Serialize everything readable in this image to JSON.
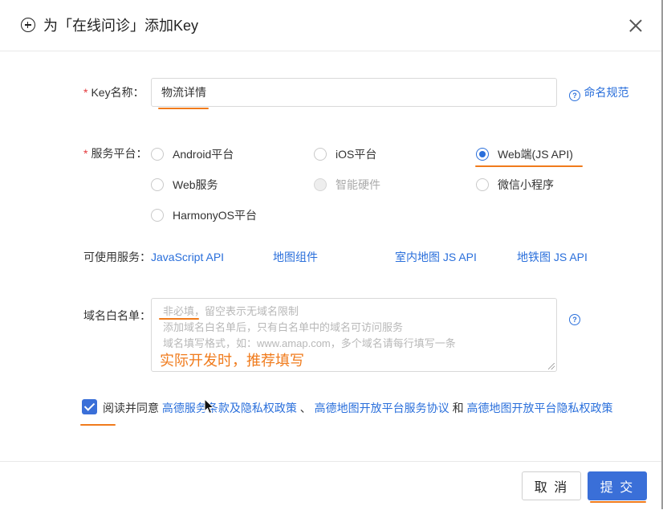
{
  "dialog": {
    "title": "为「在线问诊」添加Key",
    "icons": {
      "add": "plus-circle-icon",
      "close": "close-icon"
    }
  },
  "key_name": {
    "label": "Key名称：",
    "value": "物流详情",
    "help_link": "命名规范"
  },
  "platform": {
    "label": "服务平台：",
    "options": [
      {
        "label": "Android平台",
        "checked": false,
        "disabled": false
      },
      {
        "label": "iOS平台",
        "checked": false,
        "disabled": false
      },
      {
        "label": "Web端(JS API)",
        "checked": true,
        "disabled": false
      },
      {
        "label": "Web服务",
        "checked": false,
        "disabled": false
      },
      {
        "label": "智能硬件",
        "checked": false,
        "disabled": true
      },
      {
        "label": "微信小程序",
        "checked": false,
        "disabled": false
      },
      {
        "label": "HarmonyOS平台",
        "checked": false,
        "disabled": false
      }
    ]
  },
  "available_services": {
    "label": "可使用服务：",
    "items": [
      "JavaScript API",
      "地图组件",
      "室内地图 JS API",
      "地铁图 JS API"
    ]
  },
  "domain_whitelist": {
    "label": "域名白名单：",
    "placeholder_lines": [
      "非必填，留空表示无域名限制",
      "添加域名白名单后，只有白名单中的域名可访问服务",
      "域名填写格式，如：www.amap.com，多个域名请每行填写一条"
    ],
    "annotation": "实际开发时，推荐填写"
  },
  "agreement": {
    "checked": true,
    "prefix": "阅读并同意",
    "link1": "高德服务条款及隐私权政策",
    "sep1": "、",
    "link2": "高德地图开放平台服务协议",
    "sep2": "和",
    "link3": "高德地图开放平台隐私权政策"
  },
  "footer": {
    "cancel_label": "取 消",
    "submit_label": "提 交"
  },
  "colors": {
    "accent": "#3a6fd8",
    "link": "#2a6fdb",
    "required": "#e4393c",
    "annotation": "#f07b1c"
  }
}
